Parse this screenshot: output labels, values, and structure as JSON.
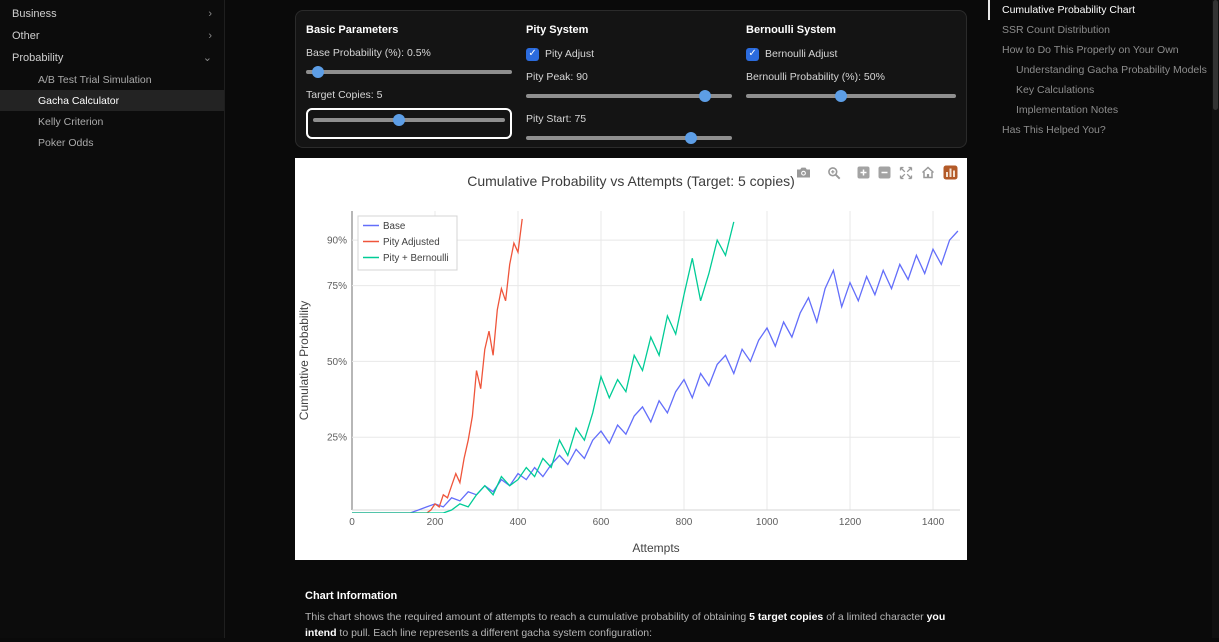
{
  "icons": {
    "chevron_right": "›",
    "chevron_down": "⌄",
    "check": "✓"
  },
  "sidebar": {
    "groups": [
      {
        "label": "Business",
        "expanded": false
      },
      {
        "label": "Other",
        "expanded": false
      },
      {
        "label": "Probability",
        "expanded": true
      }
    ],
    "items": [
      {
        "label": "A/B Test Trial Simulation",
        "active": false
      },
      {
        "label": "Gacha Calculator",
        "active": true
      },
      {
        "label": "Kelly Criterion",
        "active": false
      },
      {
        "label": "Poker Odds",
        "active": false
      }
    ]
  },
  "controls": {
    "basic": {
      "title": "Basic Parameters",
      "base_probability": {
        "label": "Base Probability (%): 0.5%",
        "pos": 6
      },
      "target_copies": {
        "label": "Target Copies: 5",
        "pos": 45,
        "focused": true
      }
    },
    "pity": {
      "title": "Pity System",
      "adjust_label": "Pity Adjust",
      "adjust_checked": true,
      "peak": {
        "label": "Pity Peak: 90",
        "pos": 87
      },
      "start": {
        "label": "Pity Start: 75",
        "pos": 80
      }
    },
    "bernoulli": {
      "title": "Bernoulli System",
      "adjust_label": "Bernoulli Adjust",
      "adjust_checked": true,
      "probability": {
        "label": "Bernoulli Probability (%): 50%",
        "pos": 45
      }
    }
  },
  "modebar_icons": [
    "camera",
    "zoom",
    "zoom-in",
    "zoom-out",
    "autoscale",
    "reset-axes",
    "plotly-logo"
  ],
  "chart_data": {
    "type": "line",
    "title": "Cumulative Probability vs Attempts (Target: 5 copies)",
    "xlabel": "Attempts",
    "ylabel": "Cumulative Probability",
    "xlim": [
      0,
      1465
    ],
    "ylim": [
      0,
      99.6
    ],
    "grid": true,
    "legend_position": "top-left",
    "xticks": [
      0,
      200,
      400,
      600,
      800,
      1000,
      1200,
      1400
    ],
    "xtick_labels": [
      "0",
      "200",
      "400",
      "600",
      "800",
      "1000",
      "1200",
      "1400"
    ],
    "ytick_values": [
      25,
      50,
      75,
      90
    ],
    "ytick_labels": [
      "25%",
      "50%",
      "75%",
      "90%"
    ],
    "series": [
      {
        "name": "Base",
        "color": "#636efa",
        "x0": 0,
        "dx": 20,
        "y": [
          0,
          0,
          0,
          0,
          0,
          0,
          0,
          0,
          1,
          2,
          3,
          2,
          5,
          4,
          7,
          6,
          9,
          7,
          11,
          9,
          13,
          11,
          15,
          12,
          16,
          19,
          16,
          21,
          18,
          24,
          27,
          23,
          29,
          26,
          32,
          35,
          30,
          37,
          33,
          40,
          44,
          38,
          46,
          42,
          49,
          52,
          46,
          54,
          50,
          57,
          61,
          55,
          63,
          58,
          66,
          71,
          63,
          74,
          80,
          68,
          76,
          70,
          78,
          72,
          80,
          74,
          82,
          77,
          85,
          79,
          87,
          82,
          90,
          93
        ]
      },
      {
        "name": "Pity Adjusted",
        "color": "#ef553b",
        "x": [
          0,
          40,
          80,
          120,
          160,
          180,
          190,
          200,
          210,
          220,
          230,
          240,
          250,
          260,
          270,
          280,
          290,
          300,
          310,
          320,
          330,
          340,
          350,
          360,
          370,
          380,
          390,
          400,
          410
        ],
        "y": [
          0,
          0,
          0,
          0,
          0,
          0,
          1,
          3,
          2,
          6,
          5,
          9,
          13,
          10,
          18,
          24,
          32,
          47,
          41,
          54,
          60,
          52,
          67,
          74,
          70,
          82,
          89,
          86,
          97
        ]
      },
      {
        "name": "Pity + Bernoulli",
        "color": "#00cc96",
        "x0": 0,
        "dx": 20,
        "y": [
          0,
          0,
          0,
          0,
          0,
          0,
          0,
          0,
          0,
          0,
          0,
          0,
          1,
          3,
          2,
          6,
          9,
          6,
          12,
          9,
          11,
          15,
          12,
          18,
          15,
          24,
          19,
          28,
          24,
          33,
          45,
          38,
          44,
          40,
          52,
          47,
          58,
          52,
          65,
          59,
          72,
          84,
          70,
          79,
          90,
          85,
          96
        ]
      }
    ]
  },
  "info": {
    "title": "Chart Information",
    "parts": [
      {
        "text": "This chart shows the required amount of attempts to reach a cumulative probability of obtaining ",
        "bold": false
      },
      {
        "text": "5 target copies",
        "bold": true
      },
      {
        "text": " of a limited character ",
        "bold": false
      },
      {
        "text": "you intend",
        "bold": true
      },
      {
        "text": " to pull. Each line represents a different gacha system configuration:",
        "bold": false
      }
    ]
  },
  "toc": {
    "items": [
      {
        "label": "Cumulative Probability Chart",
        "level": 0,
        "active": true
      },
      {
        "label": "SSR Count Distribution",
        "level": 0,
        "active": false
      },
      {
        "label": "How to Do This Properly on Your Own",
        "level": 0,
        "active": false
      },
      {
        "label": "Understanding Gacha Probability Models",
        "level": 1,
        "active": false
      },
      {
        "label": "Key Calculations",
        "level": 1,
        "active": false
      },
      {
        "label": "Implementation Notes",
        "level": 1,
        "active": false
      },
      {
        "label": "Has This Helped You?",
        "level": 0,
        "active": false
      }
    ]
  }
}
